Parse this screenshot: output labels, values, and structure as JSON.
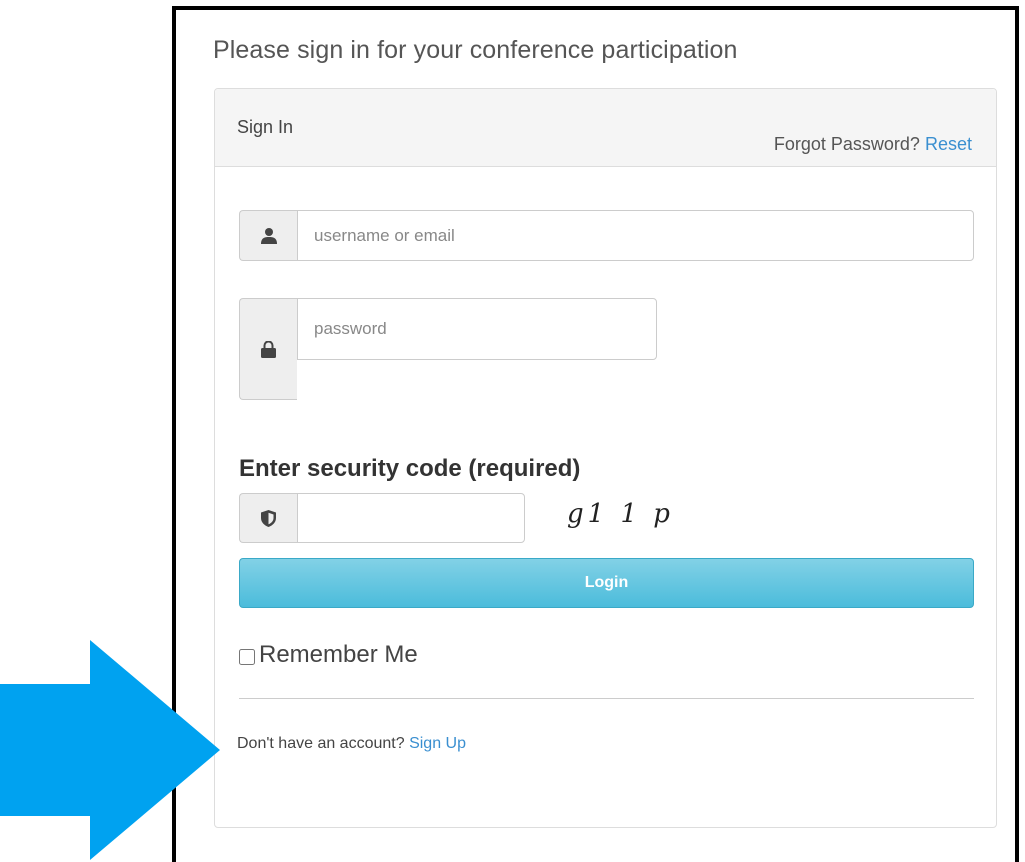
{
  "page": {
    "title": "Please sign in for your conference participation"
  },
  "panel": {
    "heading": "Sign In",
    "forgot_text": "Forgot Password?",
    "forgot_link": "Reset"
  },
  "form": {
    "username": {
      "placeholder": "username or email",
      "value": "",
      "icon": "user-icon"
    },
    "password": {
      "placeholder": "password",
      "value": "",
      "icon": "lock-icon"
    },
    "security": {
      "label": "Enter security code (required)",
      "value": "",
      "icon": "shield-icon",
      "captcha": "g1 1 p"
    },
    "login_label": "Login",
    "remember_label": "Remember Me",
    "remember_checked": false
  },
  "footer": {
    "signup_text": "Don't have an account?",
    "signup_link": "Sign Up"
  },
  "colors": {
    "accent": "#4bbcdb",
    "link": "#3a8fd0",
    "arrow": "#00a2f0"
  }
}
